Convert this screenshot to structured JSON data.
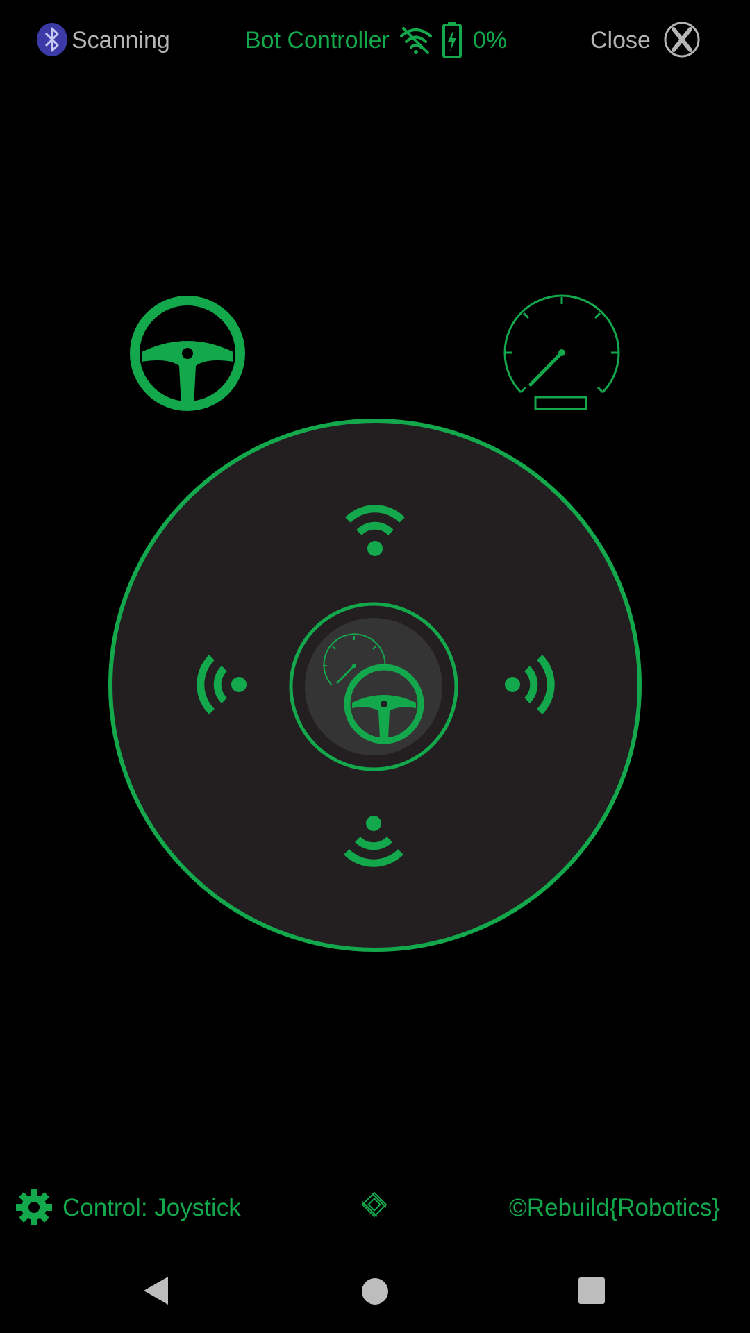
{
  "top_bar": {
    "bluetooth_status": "Scanning",
    "title": "Bot Controller",
    "battery_percent": "0%",
    "close_label": "Close",
    "icons": [
      "bluetooth-icon",
      "wifi-off-icon",
      "battery-charging-icon",
      "close-icon"
    ]
  },
  "modes": {
    "icons": [
      "steering-wheel-icon",
      "speedometer-icon"
    ]
  },
  "joystick": {
    "direction_icons": [
      "signal-up-icon",
      "signal-down-icon",
      "signal-left-icon",
      "signal-right-icon"
    ],
    "knob_icons": [
      "speedometer-icon",
      "steering-wheel-icon"
    ]
  },
  "bottom_bar": {
    "control_label": "Control: Joystick",
    "brand": "©Rebuild{Robotics}",
    "icons": [
      "gear-icon",
      "chip-icon"
    ]
  },
  "nav_bar": {
    "icons": [
      "back-icon",
      "home-icon",
      "recent-apps-icon"
    ]
  },
  "colors": {
    "accent": "#14a84c",
    "pad_fill": "#231f20",
    "knob_fill": "#353435",
    "muted_text": "#b5b5b5",
    "bluetooth": "#3c3aa6",
    "background": "#000000"
  }
}
